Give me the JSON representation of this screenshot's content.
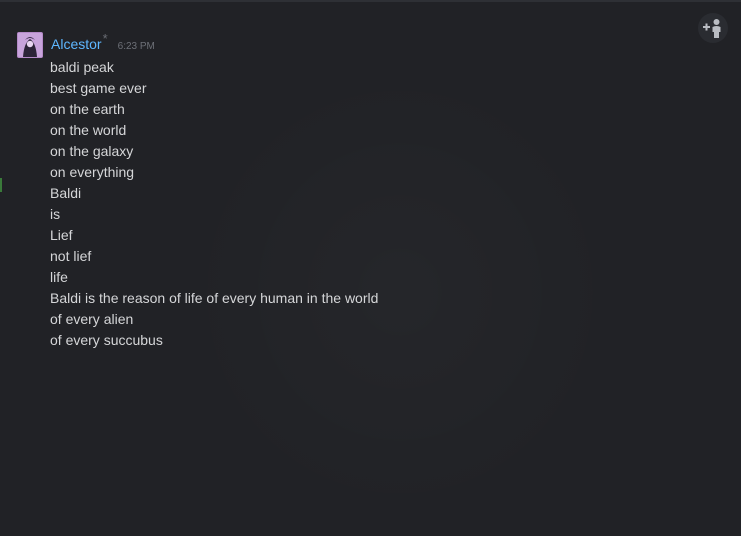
{
  "chat": {
    "add_friend_icon": "add-person-icon",
    "message": {
      "avatar_icon": "user-avatar",
      "username": "Alcestor",
      "user_mark": "*",
      "timestamp": "6:23 PM",
      "lines": [
        "baldi peak",
        "best game ever",
        "on the earth",
        "on the world",
        "on the galaxy",
        "on everything",
        "Baldi",
        "is",
        "Lief",
        "not lief",
        "life",
        "Baldi is the reason of life of every human in the world",
        "of every alien",
        "of every succubus"
      ]
    },
    "colors": {
      "background": "#212226",
      "username": "#5eb7ff",
      "text": "#d5d6d8",
      "timestamp": "#6d7077"
    }
  }
}
